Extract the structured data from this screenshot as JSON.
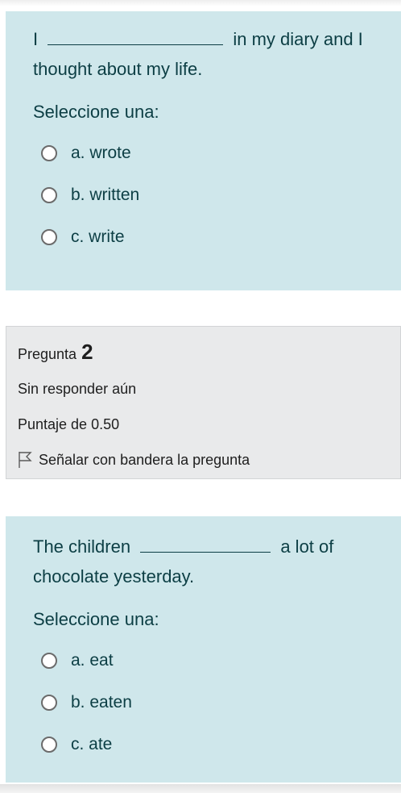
{
  "question1": {
    "text_before": "I",
    "text_after": "in my diary and I",
    "text_line2": "thought about my life.",
    "prompt": "Seleccione una:",
    "options": [
      {
        "label": "a. wrote"
      },
      {
        "label": "b. written"
      },
      {
        "label": "c. write"
      }
    ]
  },
  "question2_info": {
    "title_prefix": "Pregunta",
    "number": "2",
    "status": "Sin responder aún",
    "score": "Puntaje de 0.50",
    "flag_label": "Señalar con bandera la pregunta",
    "flag_icon": "flag-outline-icon"
  },
  "question2": {
    "text_before": "The children",
    "text_after": "a lot of",
    "text_line2": "chocolate yesterday.",
    "prompt": "Seleccione una:",
    "options": [
      {
        "label": "a. eat"
      },
      {
        "label": "b. eaten"
      },
      {
        "label": "c. ate"
      }
    ]
  }
}
